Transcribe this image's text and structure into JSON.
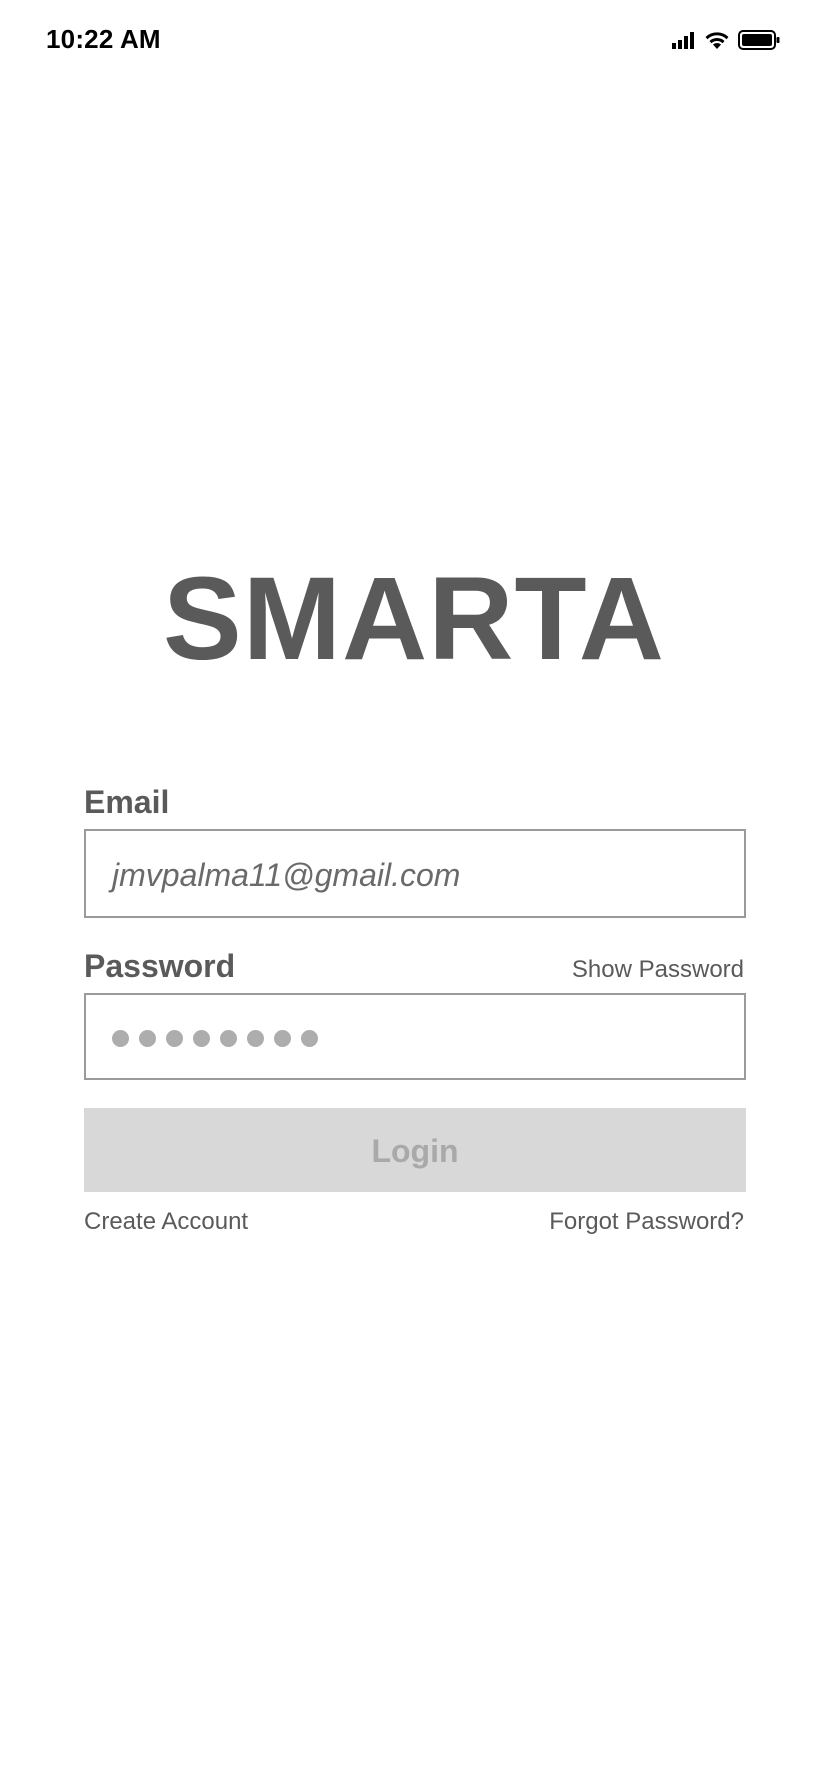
{
  "status_bar": {
    "time": "10:22 AM",
    "icons": [
      "cellular-signal-icon",
      "wifi-icon",
      "battery-icon"
    ]
  },
  "logo": {
    "text": "SMARTA"
  },
  "email": {
    "label": "Email",
    "value": "jmvpalma11@gmail.com"
  },
  "password": {
    "label": "Password",
    "show_label": "Show Password",
    "masked_length": 8
  },
  "login": {
    "label": "Login"
  },
  "links": {
    "create_account": "Create Account",
    "forgot_password": "Forgot Password?"
  },
  "colors": {
    "text": "#5a5a5a",
    "input_border": "#9a9a9a",
    "button_bg": "#d8d8d8",
    "button_text": "#a9a9a9",
    "mask_dot": "#adadad"
  }
}
